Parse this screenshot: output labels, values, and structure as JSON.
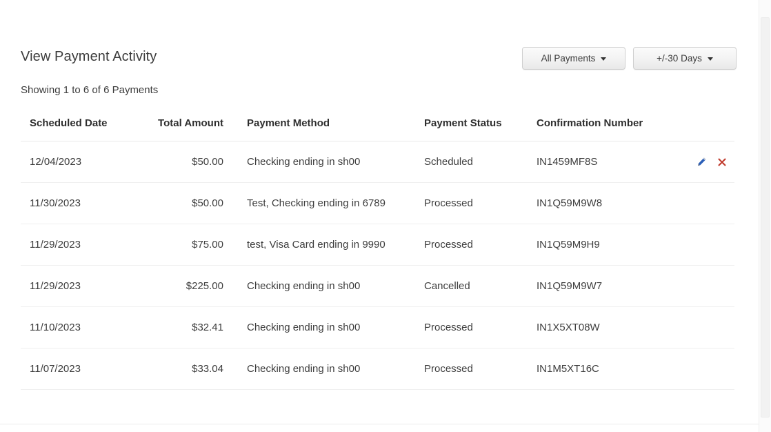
{
  "header": {
    "title": "View Payment Activity",
    "showing": "Showing 1 to 6 of 6 Payments",
    "filters": [
      {
        "label": "All Payments",
        "name": "payments-filter"
      },
      {
        "label": "+/-30 Days",
        "name": "date-range-filter"
      }
    ]
  },
  "table": {
    "columns": [
      "Scheduled Date",
      "Total Amount",
      "Payment Method",
      "Payment Status",
      "Confirmation Number"
    ],
    "rows": [
      {
        "date": "12/04/2023",
        "amount": "$50.00",
        "method": "Checking ending in sh00",
        "status": "Scheduled",
        "confirmation": "IN1459MF8S",
        "has_actions": true
      },
      {
        "date": "11/30/2023",
        "amount": "$50.00",
        "method": "Test, Checking ending in 6789",
        "status": "Processed",
        "confirmation": "IN1Q59M9W8",
        "has_actions": false
      },
      {
        "date": "11/29/2023",
        "amount": "$75.00",
        "method": "test, Visa Card ending in 9990",
        "status": "Processed",
        "confirmation": "IN1Q59M9H9",
        "has_actions": false
      },
      {
        "date": "11/29/2023",
        "amount": "$225.00",
        "method": "Checking ending in sh00",
        "status": "Cancelled",
        "confirmation": "IN1Q59M9W7",
        "has_actions": false
      },
      {
        "date": "11/10/2023",
        "amount": "$32.41",
        "method": "Checking ending in sh00",
        "status": "Processed",
        "confirmation": "IN1X5XT08W",
        "has_actions": false
      },
      {
        "date": "11/07/2023",
        "amount": "$33.04",
        "method": "Checking ending in sh00",
        "status": "Processed",
        "confirmation": "IN1M5XT16C",
        "has_actions": false
      }
    ],
    "action_icons": {
      "edit": "pencil-icon",
      "delete": "red-x-icon"
    }
  },
  "colors": {
    "edit_icon": "#2b5fb8",
    "delete_icon": "#c0392b",
    "text": "#3d3d3d",
    "rule": "#efefef"
  }
}
